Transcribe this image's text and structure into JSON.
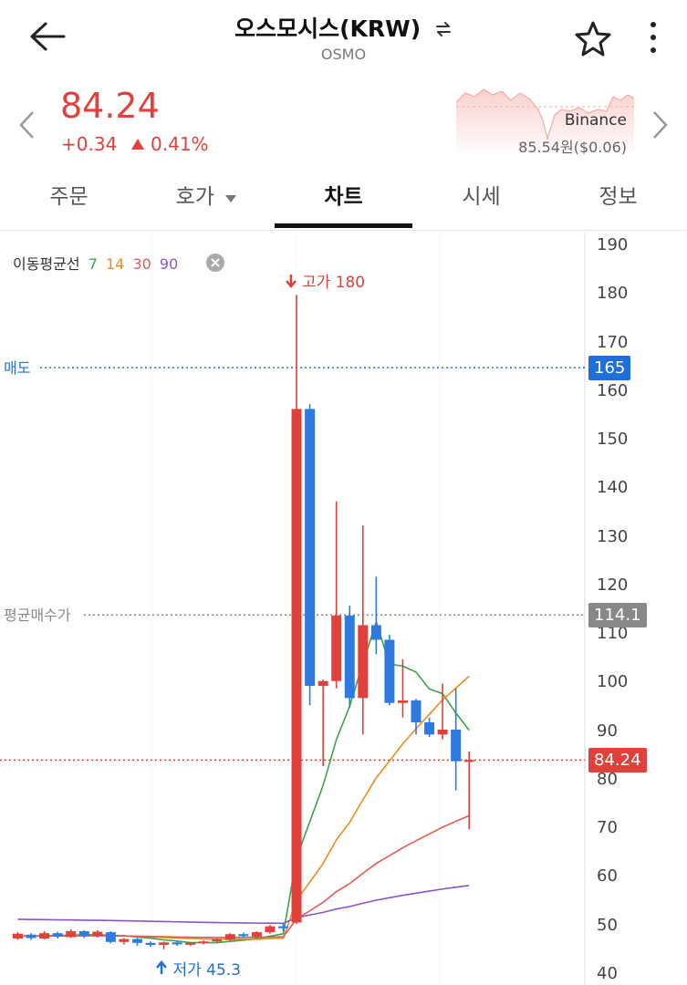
{
  "header": {
    "title": "오스모시스(KRW)",
    "subtitle": "OSMO"
  },
  "price": {
    "current": "84.24",
    "change": "+0.34",
    "change_pct": "0.41%"
  },
  "exchange": {
    "name": "Binance",
    "price": "85.54원($0.06)"
  },
  "tabs": [
    {
      "label": "주문"
    },
    {
      "label": "호가"
    },
    {
      "label": "차트"
    },
    {
      "label": "시세"
    },
    {
      "label": "정보"
    }
  ],
  "chart_data": {
    "type": "candlestick",
    "ma_legend_title": "이동평균선",
    "ma_periods": [
      "7",
      "14",
      "30",
      "90"
    ],
    "ma_colors": [
      "#3aa34a",
      "#ee8a1e",
      "#e05a5a",
      "#8a55c4"
    ],
    "y_ticks": [
      "190",
      "180",
      "170",
      "160",
      "150",
      "140",
      "130",
      "120",
      "110",
      "100",
      "90",
      "80",
      "70",
      "60",
      "50",
      "40"
    ],
    "ylim": [
      40,
      190
    ],
    "high_label": "고가 180",
    "low_label": "저가 45.3",
    "sell_line": {
      "label": "매도",
      "value": 165,
      "tag": "165",
      "color": "#1e6fd9"
    },
    "avg_buy_line": {
      "label": "평균매수가",
      "value": 114.1,
      "tag": "114.1",
      "color": "#888888"
    },
    "current_line": {
      "value": 84.24,
      "tag": "84.24",
      "color": "#e0413a"
    },
    "candles": [
      {
        "o": 47.5,
        "c": 48.5,
        "h": 48.8,
        "l": 47.2
      },
      {
        "o": 48.3,
        "c": 47.6,
        "h": 48.6,
        "l": 47.2
      },
      {
        "o": 47.5,
        "c": 48.6,
        "h": 49.0,
        "l": 47.3
      },
      {
        "o": 48.6,
        "c": 47.9,
        "h": 48.9,
        "l": 47.5
      },
      {
        "o": 47.8,
        "c": 49.0,
        "h": 49.4,
        "l": 47.6
      },
      {
        "o": 49.0,
        "c": 48.0,
        "h": 49.2,
        "l": 47.6
      },
      {
        "o": 48.0,
        "c": 48.9,
        "h": 49.2,
        "l": 47.7
      },
      {
        "o": 48.8,
        "c": 46.8,
        "h": 49.0,
        "l": 46.5
      },
      {
        "o": 46.8,
        "c": 47.4,
        "h": 47.6,
        "l": 46.3
      },
      {
        "o": 47.4,
        "c": 46.6,
        "h": 47.6,
        "l": 46.0
      },
      {
        "o": 46.6,
        "c": 46.2,
        "h": 46.9,
        "l": 45.8
      },
      {
        "o": 46.2,
        "c": 46.7,
        "h": 46.9,
        "l": 45.3
      },
      {
        "o": 46.7,
        "c": 46.3,
        "h": 46.9,
        "l": 46.0
      },
      {
        "o": 46.3,
        "c": 46.6,
        "h": 46.8,
        "l": 46.0
      },
      {
        "o": 46.6,
        "c": 46.9,
        "h": 47.1,
        "l": 46.3
      },
      {
        "o": 46.9,
        "c": 47.3,
        "h": 47.5,
        "l": 46.6
      },
      {
        "o": 47.2,
        "c": 48.4,
        "h": 48.6,
        "l": 47.0
      },
      {
        "o": 48.4,
        "c": 48.0,
        "h": 48.7,
        "l": 47.6
      },
      {
        "o": 47.9,
        "c": 48.8,
        "h": 49.0,
        "l": 47.6
      },
      {
        "o": 48.8,
        "c": 50.0,
        "h": 50.3,
        "l": 48.5
      },
      {
        "o": 50.0,
        "c": 49.8,
        "h": 50.8,
        "l": 49.0
      },
      {
        "o": 50.8,
        "c": 156.5,
        "h": 180,
        "l": 50.5
      },
      {
        "o": 156.5,
        "c": 99.5,
        "h": 157.5,
        "l": 95.5
      },
      {
        "o": 99.5,
        "c": 100.5,
        "h": 100.8,
        "l": 83.0
      },
      {
        "o": 100.5,
        "c": 114.0,
        "h": 137.5,
        "l": 99.0
      },
      {
        "o": 114.0,
        "c": 97.0,
        "h": 116.0,
        "l": 95.0
      },
      {
        "o": 97.0,
        "c": 112.0,
        "h": 132.5,
        "l": 89.5
      },
      {
        "o": 112.0,
        "c": 109.0,
        "h": 122.0,
        "l": 106.0
      },
      {
        "o": 109.0,
        "c": 96.0,
        "h": 110.0,
        "l": 95.5
      },
      {
        "o": 96.0,
        "c": 96.5,
        "h": 105.0,
        "l": 93.0
      },
      {
        "o": 96.5,
        "c": 92.0,
        "h": 96.8,
        "l": 89.5
      },
      {
        "o": 92.0,
        "c": 89.5,
        "h": 93.0,
        "l": 89.0
      },
      {
        "o": 89.5,
        "c": 90.5,
        "h": 100.0,
        "l": 88.5
      },
      {
        "o": 90.5,
        "c": 84.0,
        "h": 99.0,
        "l": 78.0
      },
      {
        "o": 84.0,
        "c": 84.24,
        "h": 86.0,
        "l": 70.0
      }
    ]
  }
}
